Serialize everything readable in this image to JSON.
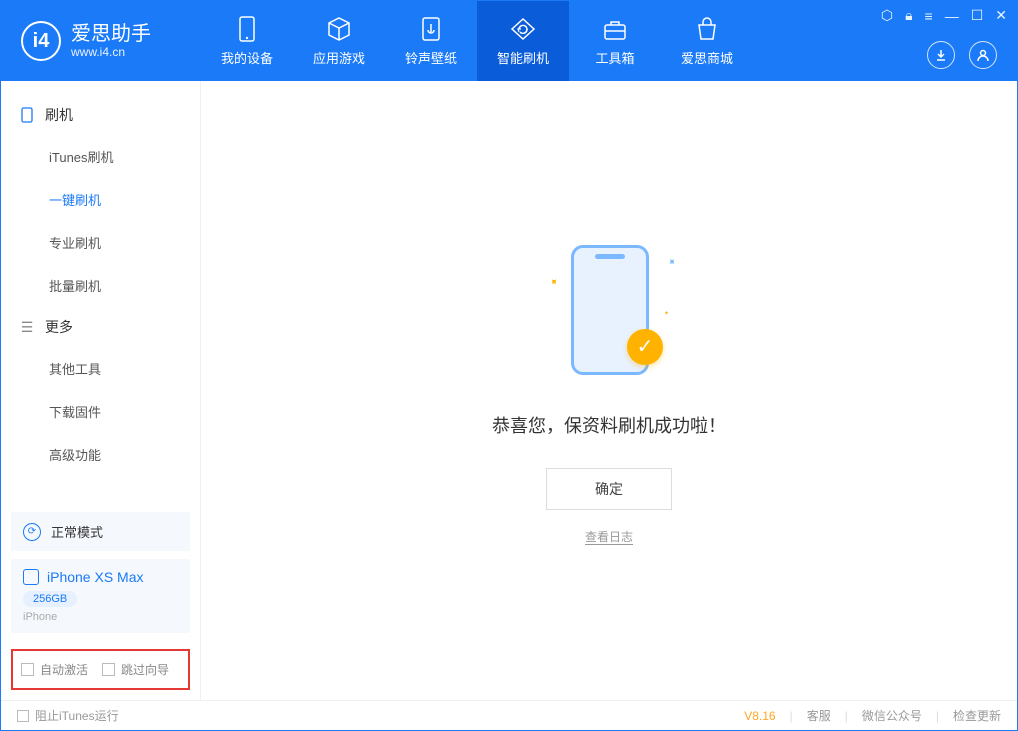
{
  "header": {
    "app_name": "爱思助手",
    "app_url": "www.i4.cn",
    "tabs": [
      {
        "label": "我的设备",
        "icon": "device"
      },
      {
        "label": "应用游戏",
        "icon": "cube"
      },
      {
        "label": "铃声壁纸",
        "icon": "music"
      },
      {
        "label": "智能刷机",
        "icon": "refresh",
        "active": true
      },
      {
        "label": "工具箱",
        "icon": "toolbox"
      },
      {
        "label": "爱思商城",
        "icon": "shop"
      }
    ]
  },
  "sidebar": {
    "section1": {
      "title": "刷机",
      "items": [
        {
          "label": "iTunes刷机"
        },
        {
          "label": "一键刷机",
          "active": true
        },
        {
          "label": "专业刷机"
        },
        {
          "label": "批量刷机"
        }
      ]
    },
    "section2": {
      "title": "更多",
      "items": [
        {
          "label": "其他工具"
        },
        {
          "label": "下载固件"
        },
        {
          "label": "高级功能"
        }
      ]
    },
    "mode": {
      "label": "正常模式"
    },
    "device": {
      "name": "iPhone XS Max",
      "storage": "256GB",
      "type": "iPhone"
    },
    "options": {
      "opt1": "自动激活",
      "opt2": "跳过向导"
    }
  },
  "main": {
    "success_text": "恭喜您，保资料刷机成功啦！",
    "ok_button": "确定",
    "log_link": "查看日志"
  },
  "footer": {
    "stop_itunes": "阻止iTunes运行",
    "version": "V8.16",
    "support": "客服",
    "wechat": "微信公众号",
    "update": "检查更新"
  }
}
